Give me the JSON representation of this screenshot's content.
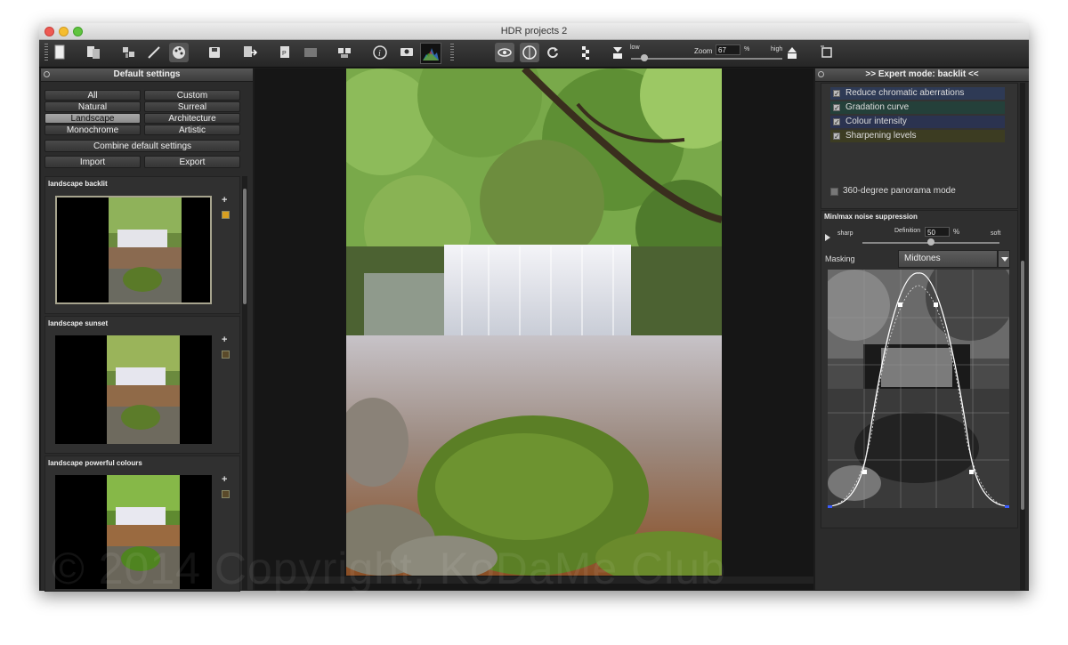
{
  "window": {
    "title": "HDR projects 2"
  },
  "toolbar": {
    "zoom_label": "Zoom",
    "zoom_value": "67",
    "zoom_unit": "%",
    "low_label": "low",
    "high_label": "high"
  },
  "left_panel": {
    "title": "Default settings",
    "filters": [
      {
        "label": "All",
        "selected": false
      },
      {
        "label": "Custom",
        "selected": false
      },
      {
        "label": "Natural",
        "selected": false
      },
      {
        "label": "Surreal",
        "selected": false
      },
      {
        "label": "Landscape",
        "selected": true
      },
      {
        "label": "Architecture",
        "selected": false
      },
      {
        "label": "Monochrome",
        "selected": false
      },
      {
        "label": "Artistic",
        "selected": false
      }
    ],
    "combine_label": "Combine default settings",
    "import_label": "Import",
    "export_label": "Export",
    "presets": [
      {
        "label": "landscape backlit",
        "selected": true
      },
      {
        "label": "landscape sunset",
        "selected": false
      },
      {
        "label": "landscape powerful colours",
        "selected": false
      }
    ]
  },
  "right_panel": {
    "title": ">> Expert mode: backlit <<",
    "modules": [
      {
        "label": "Reduce chromatic aberrations",
        "color": "#2e3a55"
      },
      {
        "label": "Gradation curve",
        "color": "#24403a"
      },
      {
        "label": "Colour intensity",
        "color": "#2b3350"
      },
      {
        "label": "Sharpening levels",
        "color": "#3c3c22"
      }
    ],
    "panorama_label": "360-degree panorama mode",
    "noise_title": "Min/max noise suppression",
    "sharp_label": "sharp",
    "soft_label": "soft",
    "definition_label": "Definition",
    "definition_value": "50",
    "definition_unit": "%",
    "definition_level": 0.5,
    "masking_label": "Masking",
    "masking_value": "Midtones"
  },
  "watermark": "© 2014 Copyright, KoDaMe Club"
}
